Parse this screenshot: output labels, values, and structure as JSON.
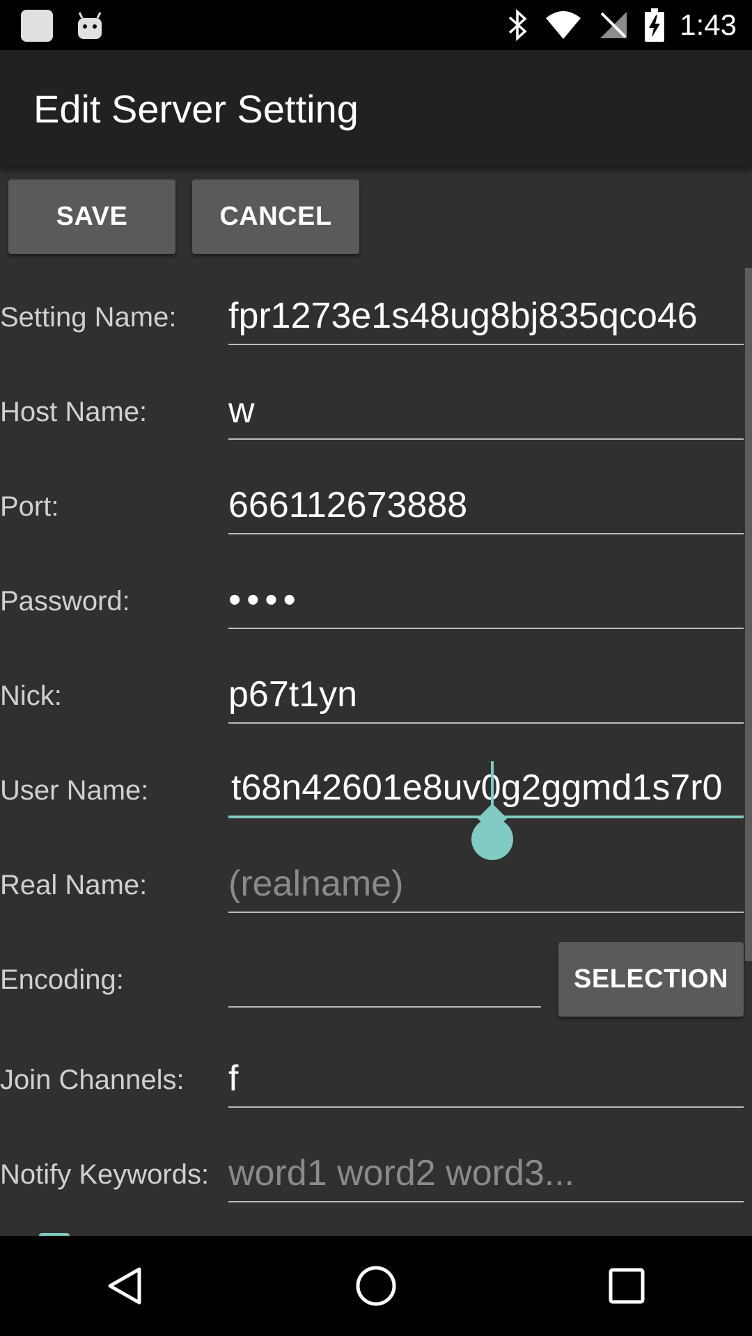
{
  "status_bar": {
    "time": "1:43",
    "icons": [
      "gallery-icon",
      "android-debug-icon",
      "bluetooth-icon",
      "wifi-icon",
      "no-sim-icon",
      "battery-charging-icon"
    ]
  },
  "app_bar": {
    "title": "Edit Server Setting"
  },
  "toolbar": {
    "save_label": "SAVE",
    "cancel_label": "CANCEL"
  },
  "form": {
    "setting_name": {
      "label": "Setting Name:",
      "value": "fpr1273e1s48ug8bj835qco46"
    },
    "host_name": {
      "label": "Host Name:",
      "value": "w"
    },
    "port": {
      "label": "Port:",
      "value": "666112673888"
    },
    "password": {
      "label": "Password:",
      "value": "••••"
    },
    "nick": {
      "label": "Nick:",
      "value": "p67t1yn"
    },
    "user_name": {
      "label": "User Name:",
      "value": "t68n42601e8uv0g2ggmd1s7r0"
    },
    "real_name": {
      "label": "Real Name:",
      "placeholder": "(realname)"
    },
    "encoding": {
      "label": "Encoding:",
      "value": "",
      "button_label": "SELECTION"
    },
    "join_channels": {
      "label": "Join Channels:",
      "value": "f"
    },
    "notify_keywords": {
      "label": "Notify Keywords:",
      "placeholder": "word1 word2 word3..."
    }
  },
  "colors": {
    "accent": "#80cbc4",
    "background": "#303030",
    "app_bar": "#212121",
    "button": "#5a5a5a"
  }
}
